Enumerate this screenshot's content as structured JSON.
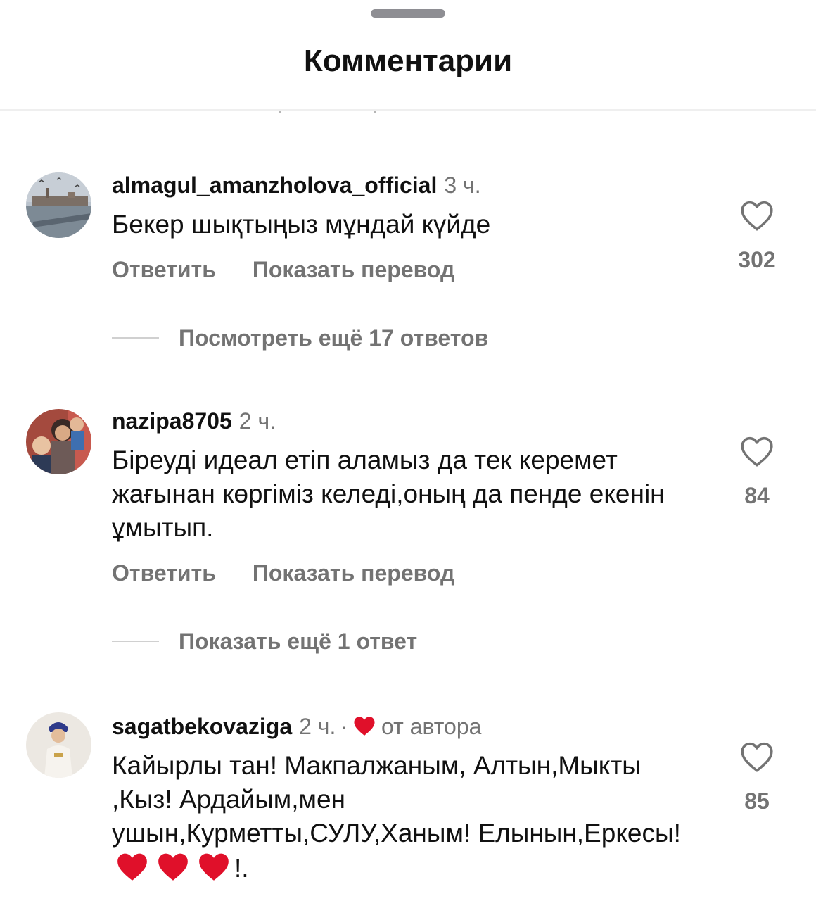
{
  "header": {
    "title": "Комментарии"
  },
  "comments": [
    {
      "username": "almagul_amanzholova_official",
      "time": "3 ч.",
      "text": "Бекер шықтыңыз мұндай күйде",
      "reply_label": "Ответить",
      "translate_label": "Показать перевод",
      "likes": "302",
      "replies_label": "Посмотреть ещё 17 ответов"
    },
    {
      "username": "nazipa8705",
      "time": "2 ч.",
      "text": "Біреуді идеал етіп аламыз да тек керемет жағынан көргіміз келеді,оның да пенде екенін ұмытып.",
      "reply_label": "Ответить",
      "translate_label": "Показать перевод",
      "likes": "84",
      "replies_label": "Показать ещё 1 ответ"
    },
    {
      "username": "sagatbekovaziga",
      "time": "2 ч.",
      "separator": "·",
      "author_badge": "от автора",
      "text": "Кайырлы тан! Макпалжаным, Алтын,Мыкты ,Кыз! Ардайым,мен ушын,Курметты,СУЛУ,Ханым! Елынын,Еркесы!",
      "text_suffix": "!.",
      "likes": "85"
    }
  ],
  "colors": {
    "heart_red": "#e0102a",
    "secondary_text": "#737373"
  },
  "icons": {
    "like": "heart-outline-icon",
    "author_like": "heart-filled-icon"
  }
}
